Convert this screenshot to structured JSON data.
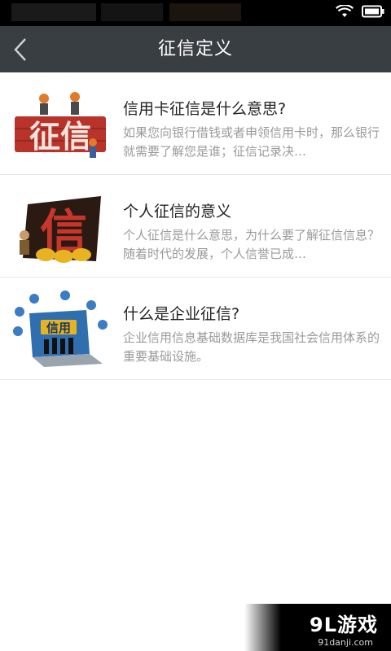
{
  "header": {
    "title": "征信定义"
  },
  "items": [
    {
      "title": "信用卡征信是什么意思?",
      "desc": "如果您向银行借钱或者申领信用卡时，那么银行就需要了解您是谁；征信记录决…",
      "thumb_text": "征信"
    },
    {
      "title": "个人征信的意义",
      "desc": "个人征信是什么意思，为什么要了解征信信息？随着时代的发展，个人信誉已成…",
      "thumb_text": "信"
    },
    {
      "title": "什么是企业征信?",
      "desc": "企业信用信息基础数据库是我国社会信用体系的重要基础设施。",
      "thumb_text": "信用"
    }
  ],
  "watermark": {
    "logo": "9L游戏",
    "url": "91danji.com"
  },
  "colors": {
    "navbar": "#393e43",
    "accent_red": "#b8342a",
    "accent_yellow": "#e8b320"
  }
}
